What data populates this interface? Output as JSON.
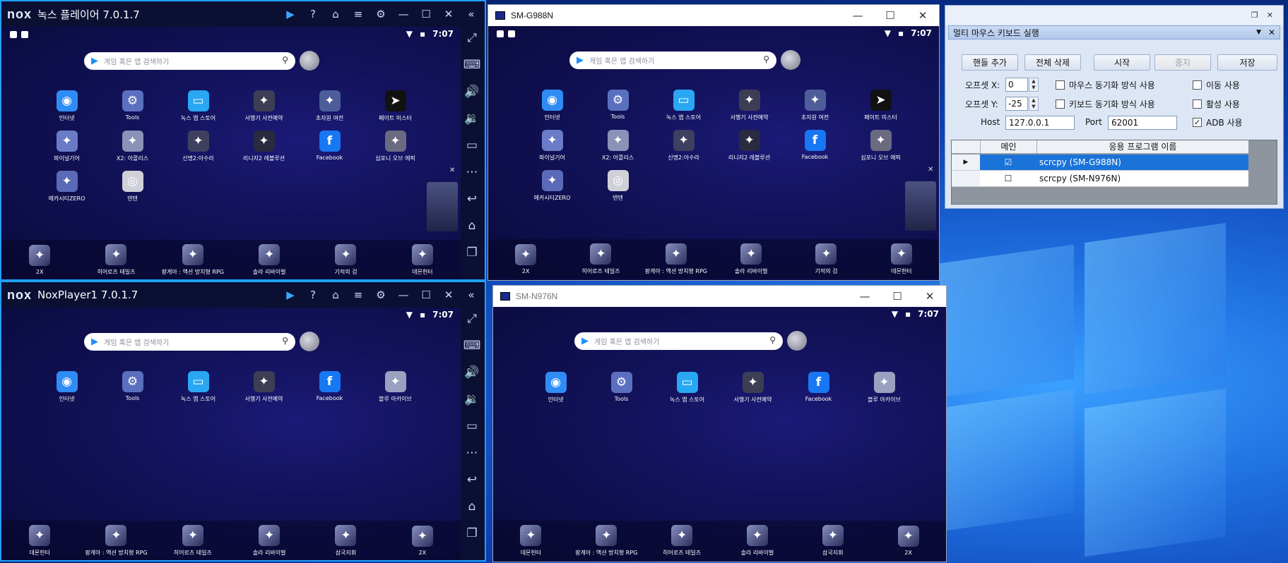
{
  "nox_top": {
    "title": "녹스 플레이어 7.0.1.7",
    "time": "7:07",
    "search_placeholder": "게임 혹은 앱 검색하기",
    "apps": [
      {
        "label": "인터넷",
        "color": "#2f8cf5",
        "glyph": "◉"
      },
      {
        "label": "Tools",
        "color": "#5b6fbf",
        "glyph": "⚙"
      },
      {
        "label": "녹스 앱 스토어",
        "color": "#29a7f2",
        "glyph": "▭"
      },
      {
        "label": "서행기 사전예약",
        "color": "#3d3d55",
        "glyph": "✦"
      },
      {
        "label": "초자원 여전",
        "color": "#4d5d9a",
        "glyph": "✦"
      },
      {
        "label": "페이트 미스터",
        "color": "#111111",
        "glyph": "➤"
      },
      {
        "label": "파이널기어",
        "color": "#6a7bc8",
        "glyph": "✦"
      },
      {
        "label": "X2: 아콜리스",
        "color": "#8a92b8",
        "glyph": "✦"
      },
      {
        "label": "신명2:아수라",
        "color": "#3f4060",
        "glyph": "✦"
      },
      {
        "label": "리니지2 레볼루션",
        "color": "#2a2a40",
        "glyph": "✦"
      },
      {
        "label": "Facebook",
        "color": "#1877f2",
        "glyph": "f"
      },
      {
        "label": "심포니 오브 에픽",
        "color": "#6a6a80",
        "glyph": "✦"
      },
      {
        "label": "메카시티ZERO",
        "color": "#5a6ab8",
        "glyph": "✦"
      },
      {
        "label": "텐텐",
        "color": "#d0d0d8",
        "glyph": "◎"
      }
    ],
    "dock": [
      "2X",
      "히어로즈 테일즈",
      "팡게아 : 액션 방치형 RPG",
      "솔라 리바이벌",
      "기적의 검",
      "데몬헌터"
    ]
  },
  "nox_bottom": {
    "title": "NoxPlayer1 7.0.1.7",
    "time": "7:07",
    "search_placeholder": "게임 혹은 앱 검색하기",
    "apps": [
      {
        "label": "인터넷",
        "color": "#2f8cf5",
        "glyph": "◉"
      },
      {
        "label": "Tools",
        "color": "#5b6fbf",
        "glyph": "⚙"
      },
      {
        "label": "녹스 앱 스토어",
        "color": "#29a7f2",
        "glyph": "▭"
      },
      {
        "label": "서행기 사전예약",
        "color": "#3d3d55",
        "glyph": "✦"
      },
      {
        "label": "Facebook",
        "color": "#1877f2",
        "glyph": "f"
      },
      {
        "label": "블루 아카이브",
        "color": "#9aa0c0",
        "glyph": "✦"
      }
    ],
    "dock": [
      "데몬헌터",
      "팡게아 : 액션 방치형 RPG",
      "히어로즈 테일즈",
      "솔라 리바이벌",
      "삼국지휘",
      "2X"
    ]
  },
  "scrcpy_g988": {
    "title": "SM-G988N",
    "time": "7:07",
    "search_placeholder": "게임 혹은 앱 검색하기",
    "apps": [
      {
        "label": "인터넷",
        "color": "#2f8cf5",
        "glyph": "◉"
      },
      {
        "label": "Tools",
        "color": "#5b6fbf",
        "glyph": "⚙"
      },
      {
        "label": "녹스 앱 스토어",
        "color": "#29a7f2",
        "glyph": "▭"
      },
      {
        "label": "서행기 사전예약",
        "color": "#3d3d55",
        "glyph": "✦"
      },
      {
        "label": "초자원 여전",
        "color": "#4d5d9a",
        "glyph": "✦"
      },
      {
        "label": "페이트 미스터",
        "color": "#111111",
        "glyph": "➤"
      },
      {
        "label": "파이널기어",
        "color": "#6a7bc8",
        "glyph": "✦"
      },
      {
        "label": "X2: 아콜리스",
        "color": "#8a92b8",
        "glyph": "✦"
      },
      {
        "label": "신명2:아수라",
        "color": "#3f4060",
        "glyph": "✦"
      },
      {
        "label": "리니지2 레볼루션",
        "color": "#2a2a40",
        "glyph": "✦"
      },
      {
        "label": "Facebook",
        "color": "#1877f2",
        "glyph": "f"
      },
      {
        "label": "심포니 오브 에픽",
        "color": "#6a6a80",
        "glyph": "✦"
      },
      {
        "label": "메카시티ZERO",
        "color": "#5a6ab8",
        "glyph": "✦"
      },
      {
        "label": "텐텐",
        "color": "#d0d0d8",
        "glyph": "◎"
      }
    ],
    "dock": [
      "2X",
      "히어로즈 테일즈",
      "팡게아 : 액션 방치형 RPG",
      "솔라 리바이벌",
      "기적의 검",
      "데몬헌터"
    ]
  },
  "scrcpy_n976": {
    "title": "SM-N976N",
    "time": "7:07",
    "search_placeholder": "게임 혹은 앱 검색하기",
    "apps": [
      {
        "label": "인터넷",
        "color": "#2f8cf5",
        "glyph": "◉"
      },
      {
        "label": "Tools",
        "color": "#5b6fbf",
        "glyph": "⚙"
      },
      {
        "label": "녹스 앱 스토어",
        "color": "#29a7f2",
        "glyph": "▭"
      },
      {
        "label": "서행기 사전예약",
        "color": "#3d3d55",
        "glyph": "✦"
      },
      {
        "label": "Facebook",
        "color": "#1877f2",
        "glyph": "f"
      },
      {
        "label": "블루 아카이브",
        "color": "#9aa0c0",
        "glyph": "✦"
      }
    ],
    "dock": [
      "데몬헌터",
      "팡게아 : 액션 방치형 RPG",
      "히어로즈 테일즈",
      "솔라 리바이벌",
      "삼국지휘",
      "2X"
    ]
  },
  "mk": {
    "title": "멀티 마우스 키보드 실행",
    "buttons": {
      "add": "핸들 추가",
      "delete_all": "전체 삭제",
      "start": "시작",
      "stop": "중지",
      "save": "저장"
    },
    "offset_x_label": "오프셋 X:",
    "offset_x": "0",
    "offset_y_label": "오프셋 Y:",
    "offset_y": "-25",
    "mouse_sync": "마우스 동기화 방식 사용",
    "keyboard_sync": "키보드 동기화 방식 사용",
    "move_use": "이동 사용",
    "active_use": "활성 사용",
    "adb_use": "ADB 사용",
    "host_label": "Host",
    "host": "127.0.0.1",
    "port_label": "Port",
    "port": "62001",
    "col_main": "메인",
    "col_name": "응용 프로그램 이름",
    "rows": [
      {
        "checked": "☑",
        "name": "scrcpy  (SM-G988N)"
      },
      {
        "checked": "☐",
        "name": "scrcpy  (SM-N976N)"
      }
    ]
  }
}
